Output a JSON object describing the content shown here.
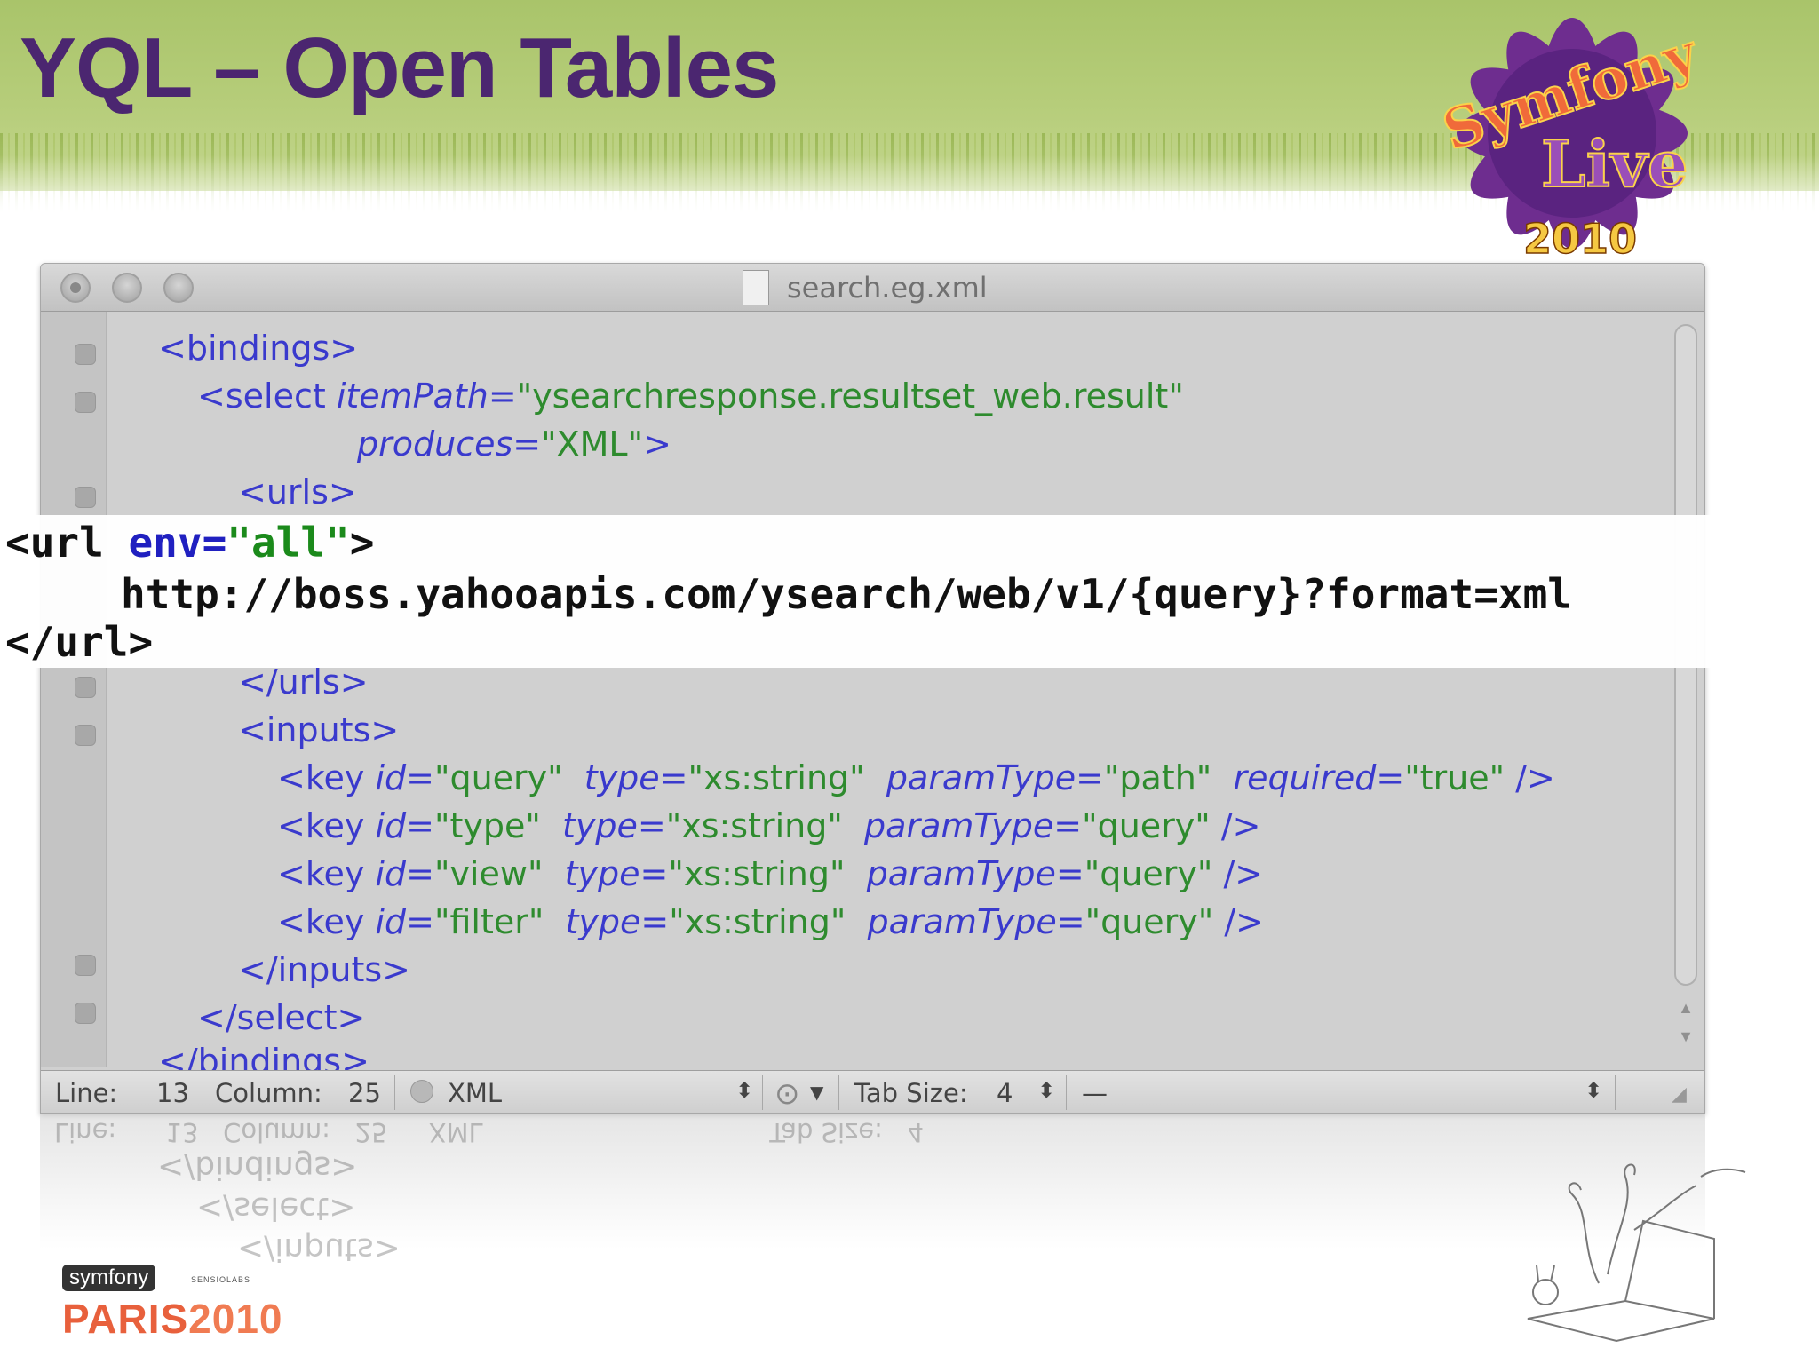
{
  "slide": {
    "title": "YQL – Open Tables"
  },
  "window": {
    "title": "search.eg.xml"
  },
  "code": {
    "l_bindings_open": "<bindings>",
    "l_select_tag": "<select ",
    "l_itempath_attr": "itemPath=",
    "l_itempath_val": "\"ysearchresponse.resultset_web.result\"",
    "l_produces_attr": "produces=",
    "l_produces_val": "\"XML\"",
    "l_produces_close": ">",
    "l_urls_open": "<urls>",
    "l_urls_close": "</urls>",
    "l_inputs_open": "<inputs>",
    "keys": [
      {
        "tag": "<key ",
        "id_attr": "id=",
        "id_val": "\"query\"",
        "type_attr": "type=",
        "type_val": "\"xs:string\"",
        "pt_attr": "paramType=",
        "pt_val": "\"path\"",
        "req_attr": "required=",
        "req_val": "\"true\"",
        "end": " />"
      },
      {
        "tag": "<key ",
        "id_attr": "id=",
        "id_val": "\"type\"",
        "type_attr": "type=",
        "type_val": "\"xs:string\"",
        "pt_attr": "paramType=",
        "pt_val": "\"query\"",
        "end": " />"
      },
      {
        "tag": "<key ",
        "id_attr": "id=",
        "id_val": "\"view\"",
        "type_attr": "type=",
        "type_val": "\"xs:string\"",
        "pt_attr": "paramType=",
        "pt_val": "\"query\"",
        "end": " />"
      },
      {
        "tag": "<key ",
        "id_attr": "id=",
        "id_val": "\"filter\"",
        "type_attr": "type=",
        "type_val": "\"xs:string\"",
        "pt_attr": "paramType=",
        "pt_val": "\"query\"",
        "end": " />"
      }
    ],
    "l_inputs_close": "</inputs>",
    "l_select_close": "</select>",
    "l_bindings_close": "</bindings>"
  },
  "overlay": {
    "url_open_tag": "<url ",
    "env_attr": "env=",
    "env_val": "\"all\"",
    "url_open_end": ">",
    "url_text": "http://boss.yahooapis.com/ysearch/web/v1/{query}?format=xml",
    "url_close": "</url>"
  },
  "status": {
    "line_label": "Line:",
    "line_value": "13",
    "column_label": "Column:",
    "column_value": "25",
    "language": "XML",
    "tab_size_label": "Tab Size:",
    "tab_size_value": "4",
    "symbol": "—"
  },
  "footer": {
    "symfony_badge": "symfony",
    "sensio": "SENSIOLABS",
    "paris": "PARIS",
    "year": "2010"
  },
  "logo": {
    "text_top": "Symfony",
    "text_mid": "Live",
    "year": "2010"
  },
  "colors": {
    "title": "#4b2670",
    "tag": "#3a3acd",
    "value": "#2e8b2e",
    "header_green": "#b6cd7a"
  }
}
